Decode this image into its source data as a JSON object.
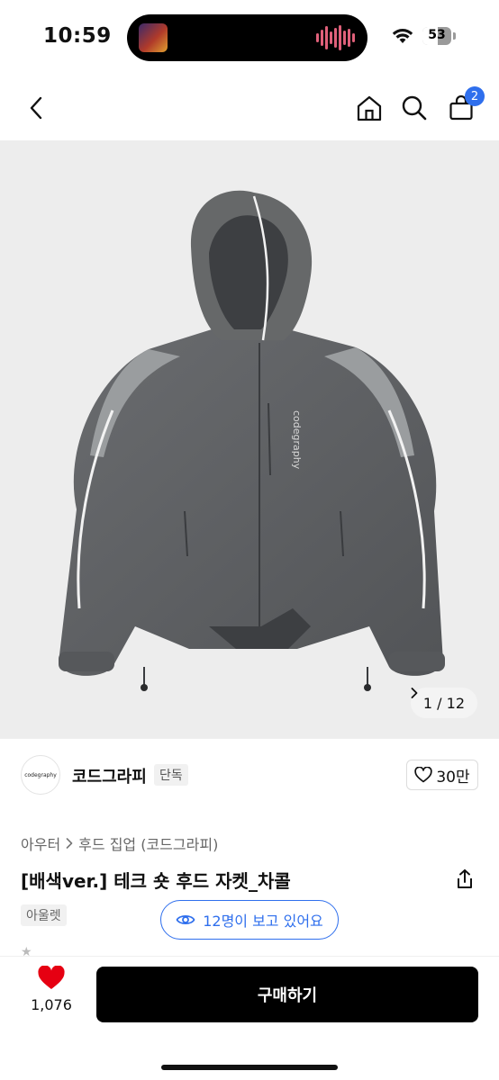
{
  "status_bar": {
    "time": "10:59",
    "battery": "53",
    "battery_level": 0.53
  },
  "nav": {
    "cart_count": "2"
  },
  "hero": {
    "image_counter": "1 / 12",
    "jacket_print": "codegraphy"
  },
  "shop": {
    "logo_text": "codegraphy",
    "name": "코드그라피",
    "tag": "단독",
    "likes": "30만"
  },
  "product": {
    "breadcrumb": [
      "아우터",
      "후드 집업 (코드그라피)"
    ],
    "title": "[배색ver.] 테크 숏 후드 자켓_차콜",
    "outlet_badge": "아울렛",
    "viewers": "12명이 보고 있어요"
  },
  "bottom_bar": {
    "wish_count": "1,076",
    "buy_label": "구매하기"
  },
  "colors": {
    "accent": "#2f6fed",
    "heart": "#e60012",
    "buy_button": "#000000",
    "jacket": "#5e6063",
    "jacket_panel": "#9a9d9f"
  }
}
